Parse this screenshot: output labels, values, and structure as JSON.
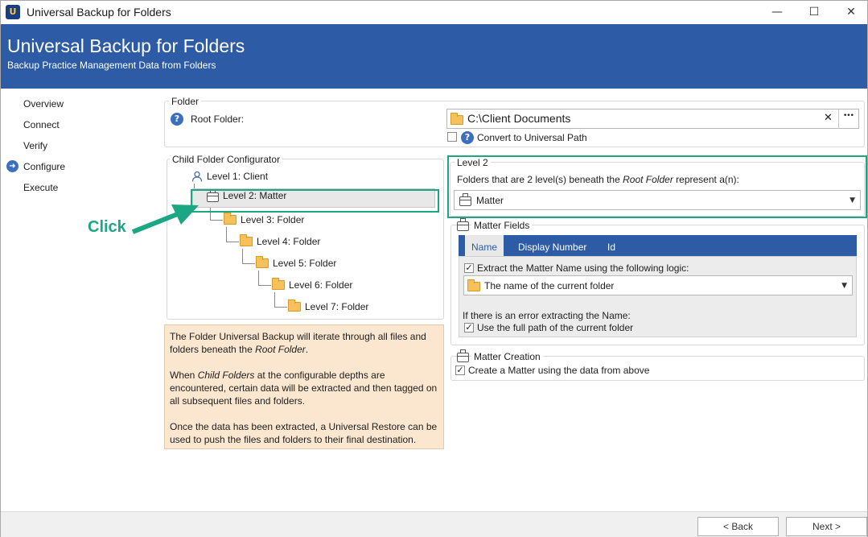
{
  "window": {
    "title": "Universal Backup for Folders",
    "minimize_glyph": "—",
    "maximize_glyph": "☐",
    "close_glyph": "✕"
  },
  "banner": {
    "title": "Universal Backup for Folders",
    "subtitle": "Backup Practice Management Data from Folders"
  },
  "nav": {
    "items": [
      {
        "label": "Overview"
      },
      {
        "label": "Connect"
      },
      {
        "label": "Verify"
      },
      {
        "label": "Configure",
        "active": true
      },
      {
        "label": "Execute"
      }
    ],
    "active_glyph": "➜"
  },
  "folder_group": {
    "label": "Folder",
    "root_label": "Root Folder:",
    "root_value": "C:\\Client Documents",
    "clear_glyph": "✕",
    "browse_glyph": "•••",
    "convert_label": "Convert to Universal Path"
  },
  "child_config": {
    "label": "Child Folder Configurator",
    "tree": [
      {
        "label": "Level 1: Client",
        "icon": "person-icon"
      },
      {
        "label": "Level 2: Matter",
        "icon": "briefcase-icon"
      },
      {
        "label": "Level 3: Folder",
        "icon": "folder-icon"
      },
      {
        "label": "Level 4: Folder",
        "icon": "folder-icon"
      },
      {
        "label": "Level 5: Folder",
        "icon": "folder-icon"
      },
      {
        "label": "Level 6: Folder",
        "icon": "folder-icon"
      },
      {
        "label": "Level 7: Folder",
        "icon": "folder-icon"
      }
    ]
  },
  "info": {
    "p1a": "The Folder Universal Backup will iterate through all files and folders beneath the ",
    "p1b": "Root Folder",
    "p1c": ".",
    "p2a": "When ",
    "p2b": "Child Folders",
    "p2c": " at the configurable depths are encountered, certain data will be extracted and then tagged on all subsequent files and folders.",
    "p3": "Once the data has been extracted, a Universal Restore can be used to push the files and folders to their final destination."
  },
  "annotation": {
    "click_label": "Click",
    "color": "#1ba784"
  },
  "level2": {
    "label": "Level 2",
    "desc_a": "Folders that are 2 level(s) beneath the ",
    "desc_b": "Root Folder",
    "desc_c": " represent a(n):",
    "select_value": "Matter",
    "arrow_glyph": "▼"
  },
  "matter_fields": {
    "label": "Matter Fields",
    "tabs": [
      {
        "label": "Name",
        "active": true
      },
      {
        "label": "Display Number"
      },
      {
        "label": "Id"
      }
    ],
    "extract_label": "Extract the Matter Name using the following logic:",
    "logic_value": "The name of the current folder",
    "error_label": "If there is an error extracting the Name:",
    "fullpath_label": "Use the full path of the current folder"
  },
  "matter_creation": {
    "label": "Matter Creation",
    "create_label": "Create a Matter using the data from above"
  },
  "footer": {
    "back_label": "< Back",
    "next_label": "Next >"
  },
  "colors": {
    "brand_blue": "#2d5ba5",
    "accent_green": "#1ba784",
    "info_bg": "#fbe7d0"
  }
}
